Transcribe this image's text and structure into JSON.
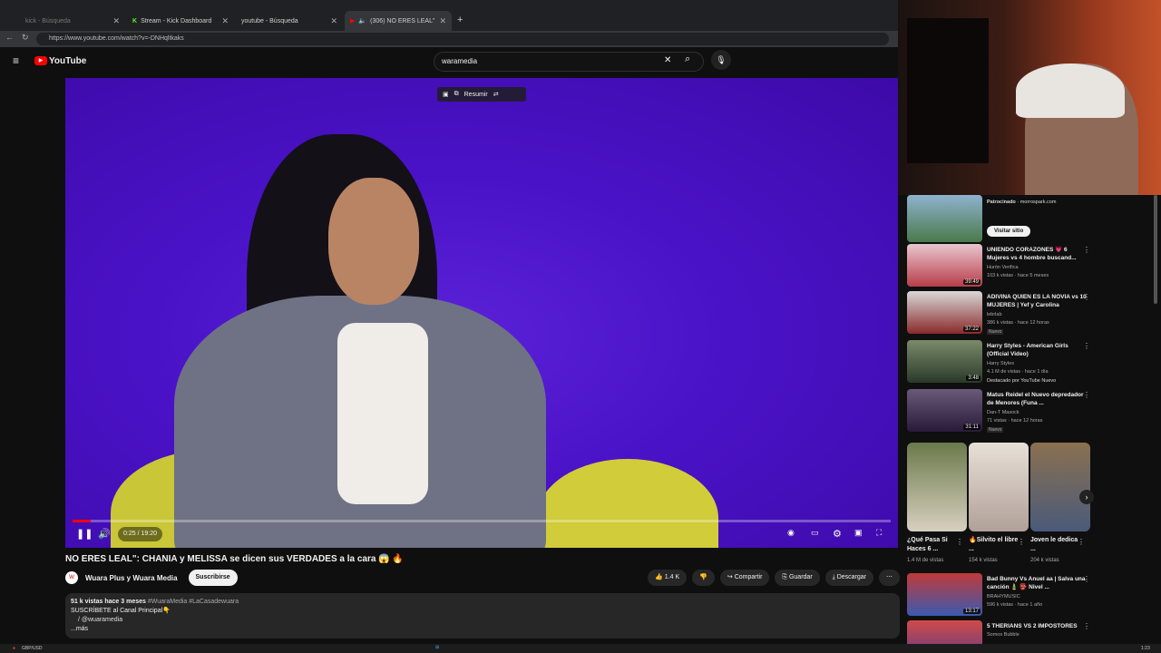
{
  "browser": {
    "tabs": [
      {
        "label": "kick - Búsqueda"
      },
      {
        "label": "Stream - Kick Dashboard"
      },
      {
        "label": "youtube - Búsqueda"
      },
      {
        "label": "(306) NO ERES LEAL\": CHANIA"
      }
    ],
    "url": "https://www.youtube.com/watch?v=-DNHqltkaks"
  },
  "yt": {
    "logo": "YouTube",
    "search_value": "waramedia"
  },
  "player": {
    "overlay_label": "Resumir",
    "time": "0:25 / 19:20",
    "progress": 0.022
  },
  "video": {
    "title": "NO ERES LEAL\": CHANIA y MELISSA se dicen sus VERDADES a la cara 😱 🔥",
    "channel": "Wuara Plus y Wuara Media",
    "subscribe": "Suscribirse",
    "likes": "1.4 K",
    "share": "Compartir",
    "save": "Guardar",
    "download": "Descargar",
    "desc_meta": "51 k vistas  hace 3 meses",
    "desc_tags": "#WuaraMedia #LaCasadewuara",
    "desc_line1": "SUSCRÍBETE al Canal Principal👇",
    "desc_line2": "/ @wuaramedia",
    "desc_more": "...más"
  },
  "sidebar": {
    "ad": {
      "sponsor": "Patrocinado",
      "domain": "· morrospark.com",
      "cta": "Visitar sitio"
    },
    "videos": [
      {
        "title": "UNIENDO CORAZONES 💗 6 Mujeres vs 4 hombre buscand...",
        "channel": "Hurón Verifica",
        "meta": "103 k vistas · hace 5 meses",
        "duration": "39:49",
        "badge": ""
      },
      {
        "title": "ADIVINA QUIEN ES LA NOVIA vs 10 MUJERES | Yef y Carolina",
        "channel": "lebrlab",
        "meta": "386 k vistas · hace 12 horas",
        "duration": "37:22",
        "badge": "Nuevo"
      },
      {
        "title": "Harry Styles - American Girls (Official Video)",
        "channel": "Harry Styles",
        "meta": "4.1 M de vistas · hace 1 día",
        "duration": "3:48",
        "badge": "Destacado por YouTube  Nuevo"
      },
      {
        "title": "Matus Reidel el Nuevo depredador de Menores (Funa ...",
        "channel": "Dan-T Masock",
        "meta": "71 vistas · hace 12 horas",
        "duration": "31:11",
        "badge": "Nuevo"
      }
    ],
    "shorts": [
      {
        "title": "¿Qué Pasa Si Haces 6 ...",
        "views": "1.4 M de vistas"
      },
      {
        "title": "🔥Silvito el libre ...",
        "views": "154 k vistas"
      },
      {
        "title": "Joven le dedica ...",
        "views": "204 k vistas"
      }
    ],
    "videos2": [
      {
        "title": "Bad Bunny Vs Anuel aa | Salva una canción 🎍 👺 Nivel ...",
        "channel": "BRAHYMUSIC",
        "meta": "596 k vistas · hace 1 año",
        "duration": "13:17"
      },
      {
        "title": "5 THERIANS VS 2 IMPOSTORES",
        "channel": "Somos Bubble",
        "meta": "",
        "duration": ""
      }
    ]
  },
  "taskbar": {
    "ticker": "GBP/USD",
    "clock": "1:23"
  },
  "colors": {
    "accent": "#ff0000",
    "video_bg": "#4a12c7"
  }
}
